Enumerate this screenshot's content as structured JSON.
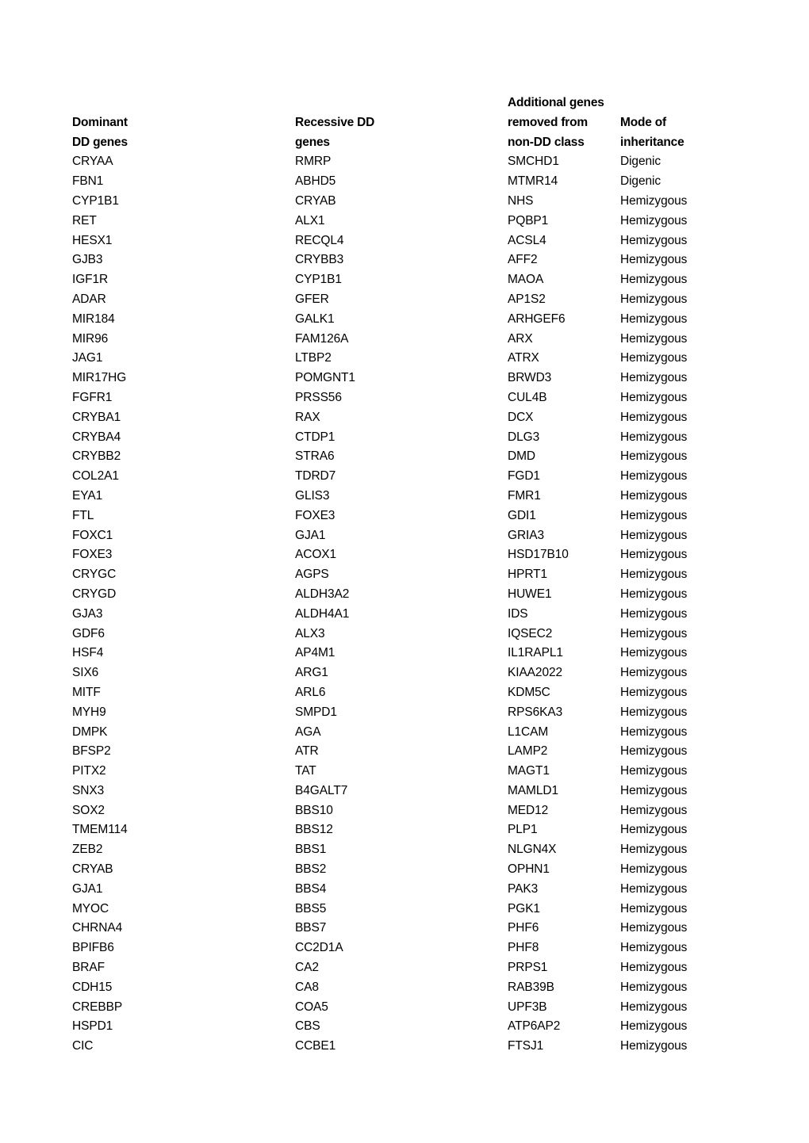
{
  "table": {
    "headers": [
      {
        "lines": [
          "",
          "Dominant",
          "DD genes"
        ]
      },
      {
        "lines": [
          "",
          "Recessive DD",
          "genes"
        ]
      },
      {
        "lines": [
          "Additional genes",
          "removed from",
          "non-DD class"
        ]
      },
      {
        "lines": [
          "",
          "Mode of",
          "inheritance"
        ]
      }
    ],
    "rows": [
      [
        "CRYAA",
        "RMRP",
        "SMCHD1",
        "Digenic"
      ],
      [
        "FBN1",
        "ABHD5",
        "MTMR14",
        "Digenic"
      ],
      [
        "CYP1B1",
        "CRYAB",
        "NHS",
        "Hemizygous"
      ],
      [
        "RET",
        "ALX1",
        "PQBP1",
        "Hemizygous"
      ],
      [
        "HESX1",
        "RECQL4",
        "ACSL4",
        "Hemizygous"
      ],
      [
        "GJB3",
        "CRYBB3",
        "AFF2",
        "Hemizygous"
      ],
      [
        "IGF1R",
        "CYP1B1",
        "MAOA",
        "Hemizygous"
      ],
      [
        "ADAR",
        "GFER",
        "AP1S2",
        "Hemizygous"
      ],
      [
        "MIR184",
        "GALK1",
        "ARHGEF6",
        "Hemizygous"
      ],
      [
        "MIR96",
        "FAM126A",
        "ARX",
        "Hemizygous"
      ],
      [
        "JAG1",
        "LTBP2",
        "ATRX",
        "Hemizygous"
      ],
      [
        "MIR17HG",
        "POMGNT1",
        "BRWD3",
        "Hemizygous"
      ],
      [
        "FGFR1",
        "PRSS56",
        "CUL4B",
        "Hemizygous"
      ],
      [
        "CRYBA1",
        "RAX",
        "DCX",
        "Hemizygous"
      ],
      [
        "CRYBA4",
        "CTDP1",
        "DLG3",
        "Hemizygous"
      ],
      [
        "CRYBB2",
        "STRA6",
        "DMD",
        "Hemizygous"
      ],
      [
        "COL2A1",
        "TDRD7",
        "FGD1",
        "Hemizygous"
      ],
      [
        "EYA1",
        "GLIS3",
        "FMR1",
        "Hemizygous"
      ],
      [
        "FTL",
        "FOXE3",
        "GDI1",
        "Hemizygous"
      ],
      [
        "FOXC1",
        "GJA1",
        "GRIA3",
        "Hemizygous"
      ],
      [
        "FOXE3",
        "ACOX1",
        "HSD17B10",
        "Hemizygous"
      ],
      [
        "CRYGC",
        "AGPS",
        "HPRT1",
        "Hemizygous"
      ],
      [
        "CRYGD",
        "ALDH3A2",
        "HUWE1",
        "Hemizygous"
      ],
      [
        "GJA3",
        "ALDH4A1",
        "IDS",
        "Hemizygous"
      ],
      [
        "GDF6",
        "ALX3",
        "IQSEC2",
        "Hemizygous"
      ],
      [
        "HSF4",
        "AP4M1",
        "IL1RAPL1",
        "Hemizygous"
      ],
      [
        "SIX6",
        "ARG1",
        "KIAA2022",
        "Hemizygous"
      ],
      [
        "MITF",
        "ARL6",
        "KDM5C",
        "Hemizygous"
      ],
      [
        "MYH9",
        "SMPD1",
        "RPS6KA3",
        "Hemizygous"
      ],
      [
        "DMPK",
        "AGA",
        "L1CAM",
        "Hemizygous"
      ],
      [
        "BFSP2",
        "ATR",
        "LAMP2",
        "Hemizygous"
      ],
      [
        "PITX2",
        "TAT",
        "MAGT1",
        "Hemizygous"
      ],
      [
        "SNX3",
        "B4GALT7",
        "MAMLD1",
        "Hemizygous"
      ],
      [
        "SOX2",
        "BBS10",
        "MED12",
        "Hemizygous"
      ],
      [
        "TMEM114",
        "BBS12",
        "PLP1",
        "Hemizygous"
      ],
      [
        "ZEB2",
        "BBS1",
        "NLGN4X",
        "Hemizygous"
      ],
      [
        "CRYAB",
        "BBS2",
        "OPHN1",
        "Hemizygous"
      ],
      [
        "GJA1",
        "BBS4",
        "PAK3",
        "Hemizygous"
      ],
      [
        "MYOC",
        "BBS5",
        "PGK1",
        "Hemizygous"
      ],
      [
        "CHRNA4",
        "BBS7",
        "PHF6",
        "Hemizygous"
      ],
      [
        "BPIFB6",
        "CC2D1A",
        "PHF8",
        "Hemizygous"
      ],
      [
        "BRAF",
        "CA2",
        "PRPS1",
        "Hemizygous"
      ],
      [
        "CDH15",
        "CA8",
        "RAB39B",
        "Hemizygous"
      ],
      [
        "CREBBP",
        "COA5",
        "UPF3B",
        "Hemizygous"
      ],
      [
        "HSPD1",
        "CBS",
        "ATP6AP2",
        "Hemizygous"
      ],
      [
        "CIC",
        "CCBE1",
        "FTSJ1",
        "Hemizygous"
      ]
    ]
  }
}
